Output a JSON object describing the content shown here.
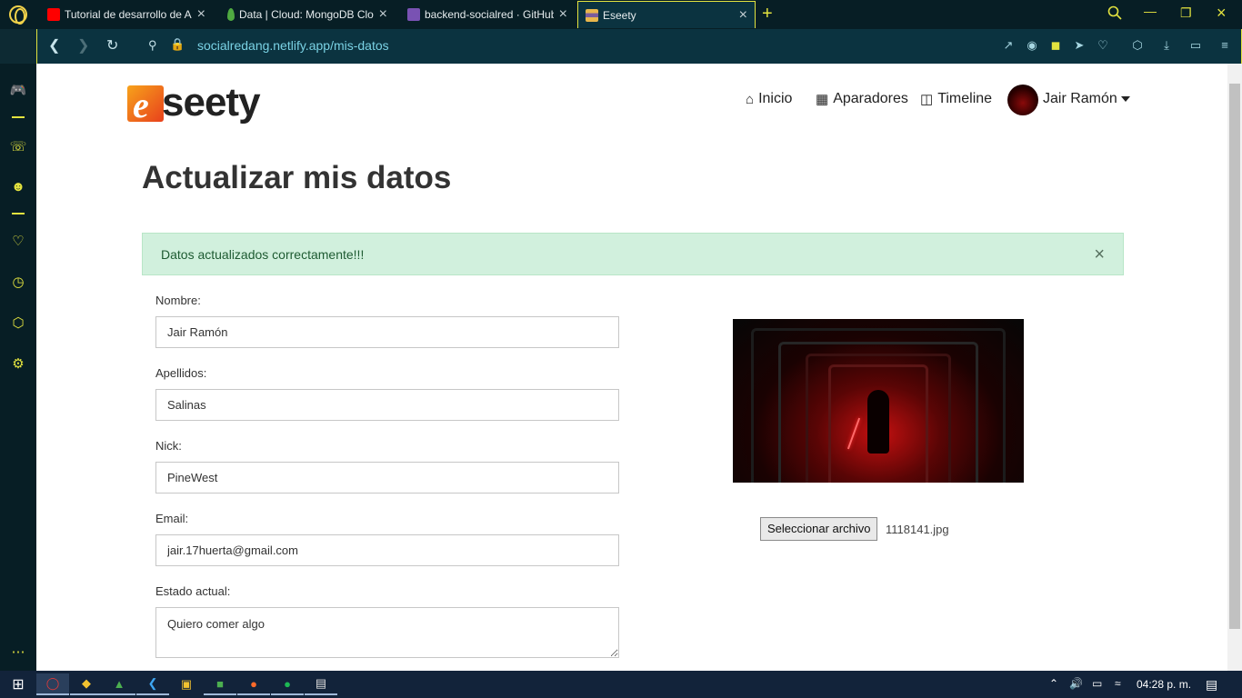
{
  "browser": {
    "tabs": [
      {
        "label": "Tutorial de desarrollo de Al",
        "favicon_color": "#ff0000"
      },
      {
        "label": "Data | Cloud: MongoDB Clo",
        "favicon_color": "#4faa41"
      },
      {
        "label": "backend-socialred · GitHub",
        "favicon_color": "#7952b3"
      },
      {
        "label": "Eseety",
        "favicon_color": "#7a5c9c"
      }
    ],
    "url_host": "socialredang.netlify.app",
    "url_path": "/mis-datos",
    "accent_color": "#e3e33f"
  },
  "site": {
    "logo_letter": "e",
    "logo_text": "seety",
    "nav": {
      "home": "Inicio",
      "showcases": "Aparadores",
      "timeline": "Timeline",
      "user": "Jair Ramón"
    }
  },
  "page": {
    "title": "Actualizar mis datos",
    "alert": {
      "text": "Datos actualizados correctamente!!!",
      "close": "×"
    },
    "form": {
      "nombre_label": "Nombre:",
      "nombre_value": "Jair Ramón",
      "apellidos_label": "Apellidos:",
      "apellidos_value": "Salinas",
      "nick_label": "Nick:",
      "nick_value": "PineWest",
      "email_label": "Email:",
      "email_value": "jair.17huerta@gmail.com",
      "estado_label": "Estado actual:",
      "estado_value": "Quiero comer algo"
    },
    "file": {
      "button": "Seleccionar archivo",
      "name": "1118141.jpg"
    }
  },
  "taskbar": {
    "clock": "04:28 p. m."
  }
}
